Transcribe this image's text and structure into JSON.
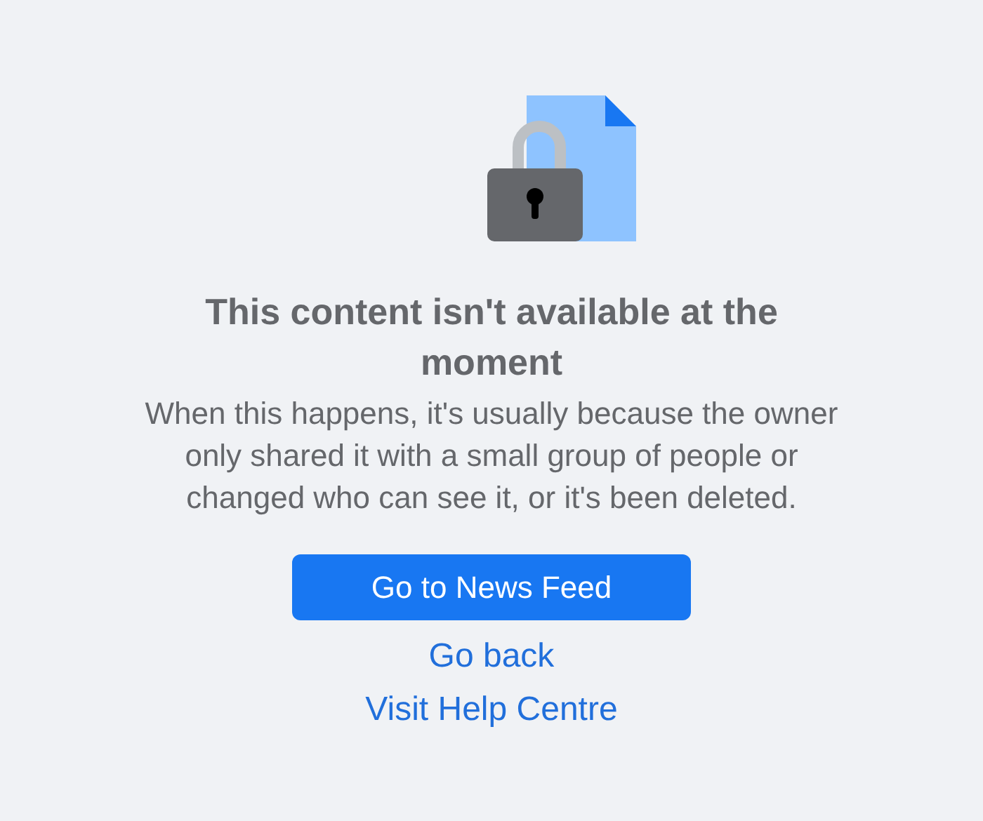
{
  "title": "This content isn't available at the moment",
  "message": "When this happens, it's usually because the owner only shared it with a small group of people or changed who can see it, or it's been deleted.",
  "primary_button": "Go to News Feed",
  "links": [
    "Go back",
    "Visit Help Centre"
  ]
}
